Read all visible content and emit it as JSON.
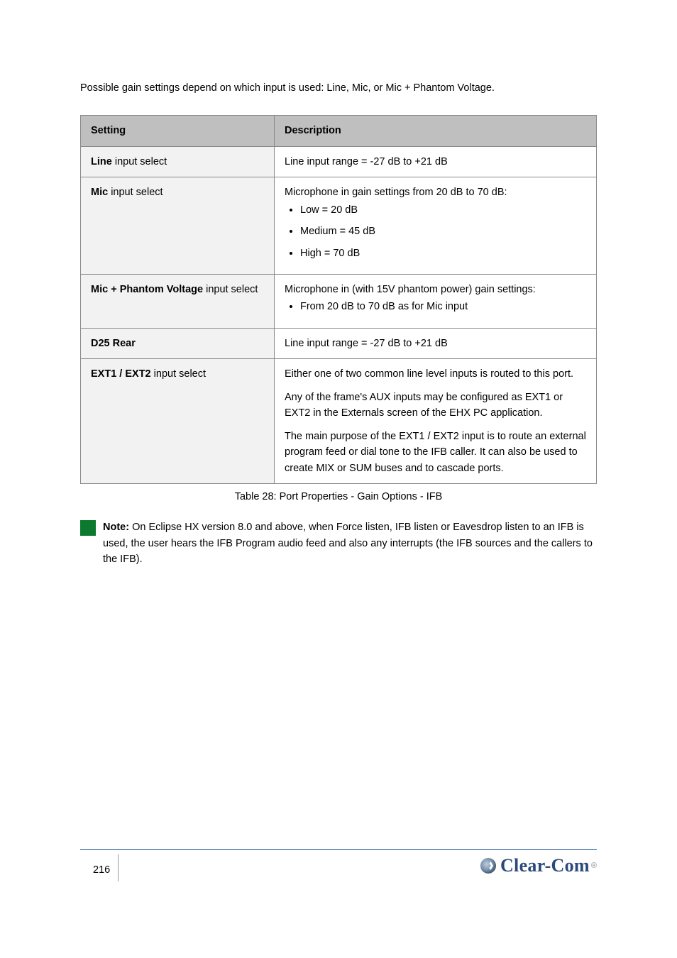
{
  "intro": "Possible gain settings depend on which input is used: Line, Mic, or Mic + Phantom Voltage.",
  "table": {
    "headers": [
      "Setting",
      "Description"
    ],
    "rows": [
      {
        "label_bold": "Line",
        "label_rest": "  input select",
        "desc_bold": "Line input",
        "desc_rest": " range = -27 dB to +21 dB"
      },
      {
        "label_bold": "Mic",
        "label_rest": " input select",
        "desc_rest": " gain settings from 20 dB to 70 dB:",
        "desc_bold": "Microphone in",
        "list": [
          "Low = 20 dB",
          "Medium = 45 dB",
          "High = 70 dB"
        ]
      },
      {
        "label_bold": "Mic + Phantom Voltage",
        "label_rest": " input select",
        "desc_bold": "Microphone in (with 15V phantom power)",
        "desc_rest": " gain settings:",
        "list": [
          "From 20 dB to 70 dB as for Mic input"
        ]
      },
      {
        "label_bold": "D25 Rear",
        "label_rest": "",
        "desc_bold": "Line input",
        "desc_rest": " range = -27 dB to +21 dB"
      },
      {
        "label_bold": "EXT1 / EXT2",
        "label_rest": " input select",
        "desc_plain": "Either one of two common line level inputs is routed to this port.",
        "desc_p2": "Any of the frame's AUX inputs may be configured as EXT1 or EXT2 in the ",
        "desc_p2_bold": "Externals",
        "desc_p2_after": " screen of the EHX PC application.",
        "desc_p3_pre": "The main purpose of the ",
        "desc_p3_bold_a": "EXT1 / EXT2",
        "desc_p3_mid": " input is to route an ",
        "desc_p3_bold_b": "external program feed or dial tone",
        "desc_p3_after": " to the IFB caller. It can also be used to create MIX or SUM buses and to cascade ports."
      }
    ]
  },
  "table_caption": "Table 28: Port Properties - Gain Options - IFB",
  "note": {
    "label": "Note:",
    "text": "On Eclipse HX version 8.0 and above, when Force listen, IFB listen or Eavesdrop listen to an IFB is used, the user hears the IFB Program audio feed and also any interrupts (the IFB sources and the callers to the IFB)."
  },
  "footer": {
    "page": "216",
    "brand": "Clear-Com",
    "reg": "®"
  }
}
